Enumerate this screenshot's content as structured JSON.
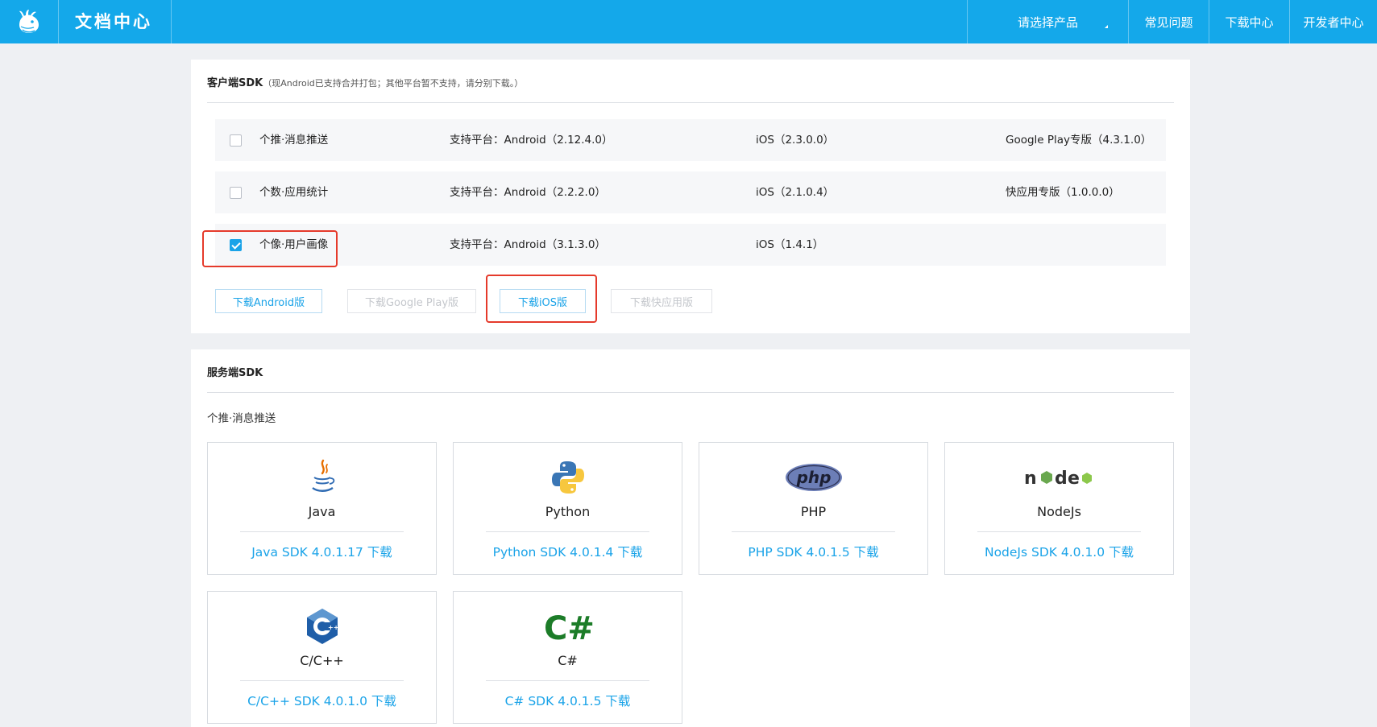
{
  "header": {
    "brand": "文档中心",
    "nav": {
      "product": "请选择产品",
      "faq": "常见问题",
      "download": "下载中心",
      "developer": "开发者中心"
    }
  },
  "client": {
    "title": "客户端SDK",
    "note": "（现Android已支持合并打包；其他平台暂不支持，请分别下载。）",
    "rows": [
      {
        "name": "个推·消息推送",
        "checked": false,
        "android": "支持平台：Android（2.12.4.0）",
        "ios": "iOS（2.3.0.0）",
        "extra": "Google Play专版（4.3.1.0）"
      },
      {
        "name": "个数·应用统计",
        "checked": false,
        "android": "支持平台：Android（2.2.2.0）",
        "ios": "iOS（2.1.0.4）",
        "extra": "快应用专版（1.0.0.0）"
      },
      {
        "name": "个像·用户画像",
        "checked": true,
        "android": "支持平台：Android（3.1.3.0）",
        "ios": "iOS（1.4.1）",
        "extra": ""
      }
    ],
    "buttons": {
      "android": "下载Android版",
      "googleplay": "下载Google Play版",
      "ios": "下载iOS版",
      "quickapp": "下载快应用版"
    }
  },
  "server": {
    "title": "服务端SDK",
    "subtitle": "个推·消息推送",
    "cards": [
      {
        "name": "Java",
        "link": "Java SDK 4.0.1.17 下载",
        "icon": "java-icon"
      },
      {
        "name": "Python",
        "link": "Python SDK 4.0.1.4 下载",
        "icon": "python-icon"
      },
      {
        "name": "PHP",
        "link": "PHP SDK 4.0.1.5 下载",
        "icon": "php-icon"
      },
      {
        "name": "NodeJs",
        "link": "NodeJs SDK 4.0.1.0 下载",
        "icon": "nodejs-icon"
      },
      {
        "name": "C/C++",
        "link": "C/C++ SDK 4.0.1.0 下载",
        "icon": "cpp-icon"
      },
      {
        "name": "C#",
        "link": "C# SDK 4.0.1.5 下载",
        "icon": "csharp-icon"
      }
    ]
  },
  "colors": {
    "header_bg": "#14a8ea",
    "accent": "#1aa3e8",
    "highlight_box": "#e53a2b",
    "page_bg": "#eef0f3"
  }
}
